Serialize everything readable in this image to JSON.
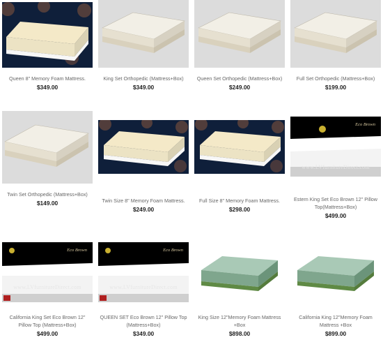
{
  "products": [
    {
      "name": "Queen 8\" Memory Foam Mattress.",
      "price": "$349.00",
      "image": "memory-foam-mattress-image"
    },
    {
      "name": "King Set Orthopedic (Mattress+Box)",
      "price": "$349.00",
      "image": "orthopedic-mattress-box-image"
    },
    {
      "name": "Queen Set Orthopedic (Mattress+Box)",
      "price": "$249.00",
      "image": "orthopedic-mattress-box-image"
    },
    {
      "name": "Full Set Orthopedic (Mattress+Box)",
      "price": "$199.00",
      "image": "orthopedic-mattress-box-image"
    },
    {
      "name": "Twin Set Orthopedic (Mattress+Box)",
      "price": "$149.00",
      "image": "orthopedic-mattress-box-image"
    },
    {
      "name": "Twin Size 8\" Memory Foam Mattress.",
      "price": "$249.00",
      "image": "memory-foam-mattress-image"
    },
    {
      "name": "Full Size 8\" Memory Foam Mattress.",
      "price": "$298.00",
      "image": "memory-foam-mattress-image"
    },
    {
      "name": "Estern King Set Eco Brown 12\" Pillow Top(Mattress+Box)",
      "price": "$499.00",
      "image": "eco-brown-pillow-top-image"
    },
    {
      "name": "California King Set Eco Brown 12\" Pillow Top (Mattress+Box)",
      "price": "$499.00",
      "image": "eco-brown-pillow-top-image"
    },
    {
      "name": "QUEEN SET Eco Brown 12\" Pillow Top (Mattress+Box)",
      "price": "$349.00",
      "image": "eco-brown-pillow-top-image"
    },
    {
      "name": "King Size 12\"Memory Foam Mattress +Box",
      "price": "$898.00",
      "image": "green-memory-foam-mattress-image"
    },
    {
      "name": "California King 12\"Memory Foam Mattress +Box",
      "price": "$899.00",
      "image": "green-memory-foam-mattress-image"
    }
  ],
  "watermark": {
    "text": "www.LVfurnitureDirect.com",
    "brand": "Eco Brown"
  },
  "colors": {
    "foam_bg": "#0f1f3a",
    "ortho_bg": "#dcdcdc",
    "eco_bg": "#000000",
    "green_mattress": "#8fb5a0"
  }
}
